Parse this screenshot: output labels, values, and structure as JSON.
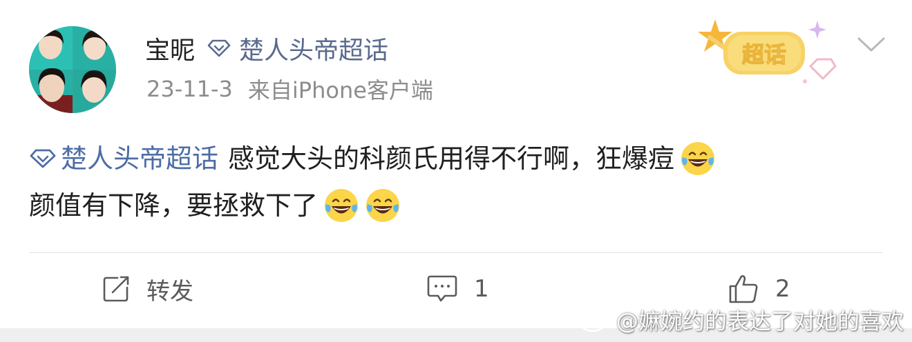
{
  "post": {
    "username": "宝昵",
    "topic_name": "楚人头帝超话",
    "date": "23-11-3",
    "source": "来自iPhone客户端",
    "badge_text": "超话",
    "content_line1_text": "感觉大头的科颜氏用得不行啊，狂爆痘",
    "content_line2_text": "颜值有下降，要拯救下了",
    "emoji_name": "laughing-tears-emoji"
  },
  "actions": {
    "repost_label": "转发",
    "comment_count": "1",
    "like_count": "2"
  },
  "watermark": {
    "text": "@嫲婉约的表达了对她的喜欢"
  },
  "colors": {
    "topic": "#4d6da6",
    "meta": "#8c8c8c",
    "action": "#5a5a5a",
    "badge": "#f5c542"
  }
}
